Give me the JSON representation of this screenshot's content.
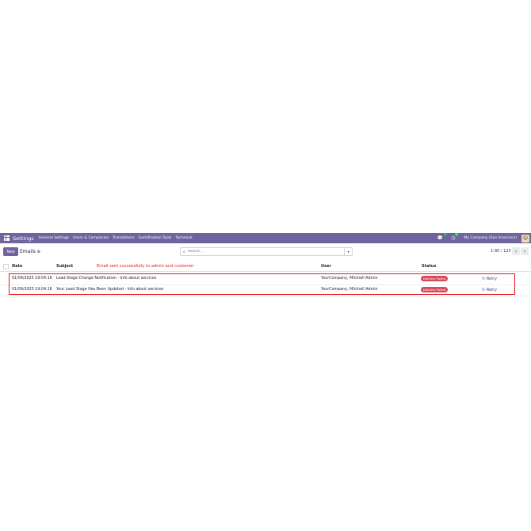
{
  "topbar": {
    "app_name": "Settings",
    "menu": [
      "General Settings",
      "Users & Companies",
      "Translations",
      "Gamification Tools",
      "Technical"
    ],
    "chat_badge": "7",
    "activity_badge": "10",
    "company": "My Company (San Francisco)",
    "color": "#71639e"
  },
  "controls": {
    "new_label": "New",
    "breadcrumb": "Emails",
    "search_placeholder": "Search...",
    "pager": "1-80 / 125"
  },
  "table": {
    "headers": {
      "date": "Date",
      "subject": "Subject",
      "user": "User",
      "status": "Status"
    },
    "annotation": "Email sent successfully to admin and customer",
    "rows": [
      {
        "date": "01/09/2025 19:04:16",
        "subject": "Lead Stage Change Notification - Info about services",
        "user": "YourCompany, Mitchell Admin",
        "status": "Delivery Failed",
        "action": "Retry"
      },
      {
        "date": "01/09/2025 19:04:16",
        "subject": "Your Lead Stage Has Been Updated - Info about services",
        "user": "YourCompany, Mitchell Admin",
        "status": "Delivery Failed",
        "action": "Retry"
      }
    ]
  }
}
